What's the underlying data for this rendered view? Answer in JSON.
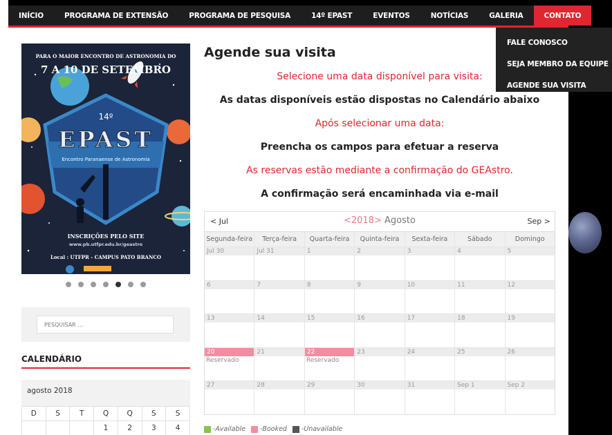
{
  "nav": {
    "items": [
      "INÍCIO",
      "PROGRAMA DE EXTENSÃO",
      "PROGRAMA DE PESQUISA",
      "14º EPAST",
      "EVENTOS",
      "NOTÍCIAS",
      "GALERIA",
      "CONTATO"
    ],
    "active": "CONTATO",
    "dropdown": [
      "FALE CONOSCO",
      "SEJA MEMBRO DA EQUIPE",
      "AGENDE SUA VISITA"
    ]
  },
  "poster": {
    "top_line": "PARA O MAIOR ENCONTRO DE ASTRONOMIA DO",
    "dates": "7 A 10 DE SETEMBRO",
    "edition": "14º",
    "name": "EPAST",
    "subtitle": "Encontro Paranaense de Astronomia",
    "inscricoes": "INSCRIÇÕES PELO SITE",
    "url": "www.pb.utfpr.edu.br/geastro",
    "local": "Local : UTFPR - CAMPUS PATO BRANCO",
    "slides": 7,
    "active_slide": 5
  },
  "search": {
    "placeholder": "PESQUISAR ..."
  },
  "sidebar_calendar": {
    "title": "CALENDÁRIO",
    "month": "agosto 2018",
    "weekdays": [
      "D",
      "S",
      "T",
      "Q",
      "Q",
      "S",
      "S"
    ],
    "first_week": [
      "",
      "",
      "",
      "1",
      "2",
      "3",
      "4"
    ]
  },
  "main": {
    "title": "Agende sua visita",
    "lines": [
      "Selecione uma data disponível para visita:",
      "As datas disponíveis estão dispostas no Calendário abaixo",
      "Após selecionar uma data:",
      "Preencha os campos para efetuar a reserva",
      "As reservas estão mediante a confirmação do GEAstro.",
      "A confirmação será encaminhada via e-mail"
    ]
  },
  "booking_calendar": {
    "prev": "< Jul",
    "year_nav": "<2018>",
    "month": "Agosto",
    "next": "Sep >",
    "weekdays": [
      "Segunda-feira",
      "Terça-feira",
      "Quarta-feira",
      "Quinta-feira",
      "Sexta-feira",
      "Sábado",
      "Domingo"
    ],
    "weeks": [
      [
        "Jul 30",
        "Jul 31",
        "1",
        "2",
        "3",
        "4",
        "5"
      ],
      [
        "6",
        "7",
        "8",
        "9",
        "10",
        "11",
        "12"
      ],
      [
        "13",
        "14",
        "15",
        "16",
        "17",
        "18",
        "19"
      ],
      [
        "20",
        "21",
        "22",
        "23",
        "24",
        "25",
        "26"
      ],
      [
        "27",
        "28",
        "29",
        "30",
        "31",
        "Sep 1",
        "Sep 2"
      ]
    ],
    "booked": [
      "20",
      "22"
    ],
    "booked_note": "Reservado",
    "legend": [
      {
        "label": "-Available",
        "color": "#8bc34a"
      },
      {
        "label": "-Booked",
        "color": "#f28ea0"
      },
      {
        "label": "-Unavailable",
        "color": "#555555"
      }
    ]
  },
  "colors": {
    "accent": "#e0262f",
    "nav_bg": "#1e1e1e"
  }
}
